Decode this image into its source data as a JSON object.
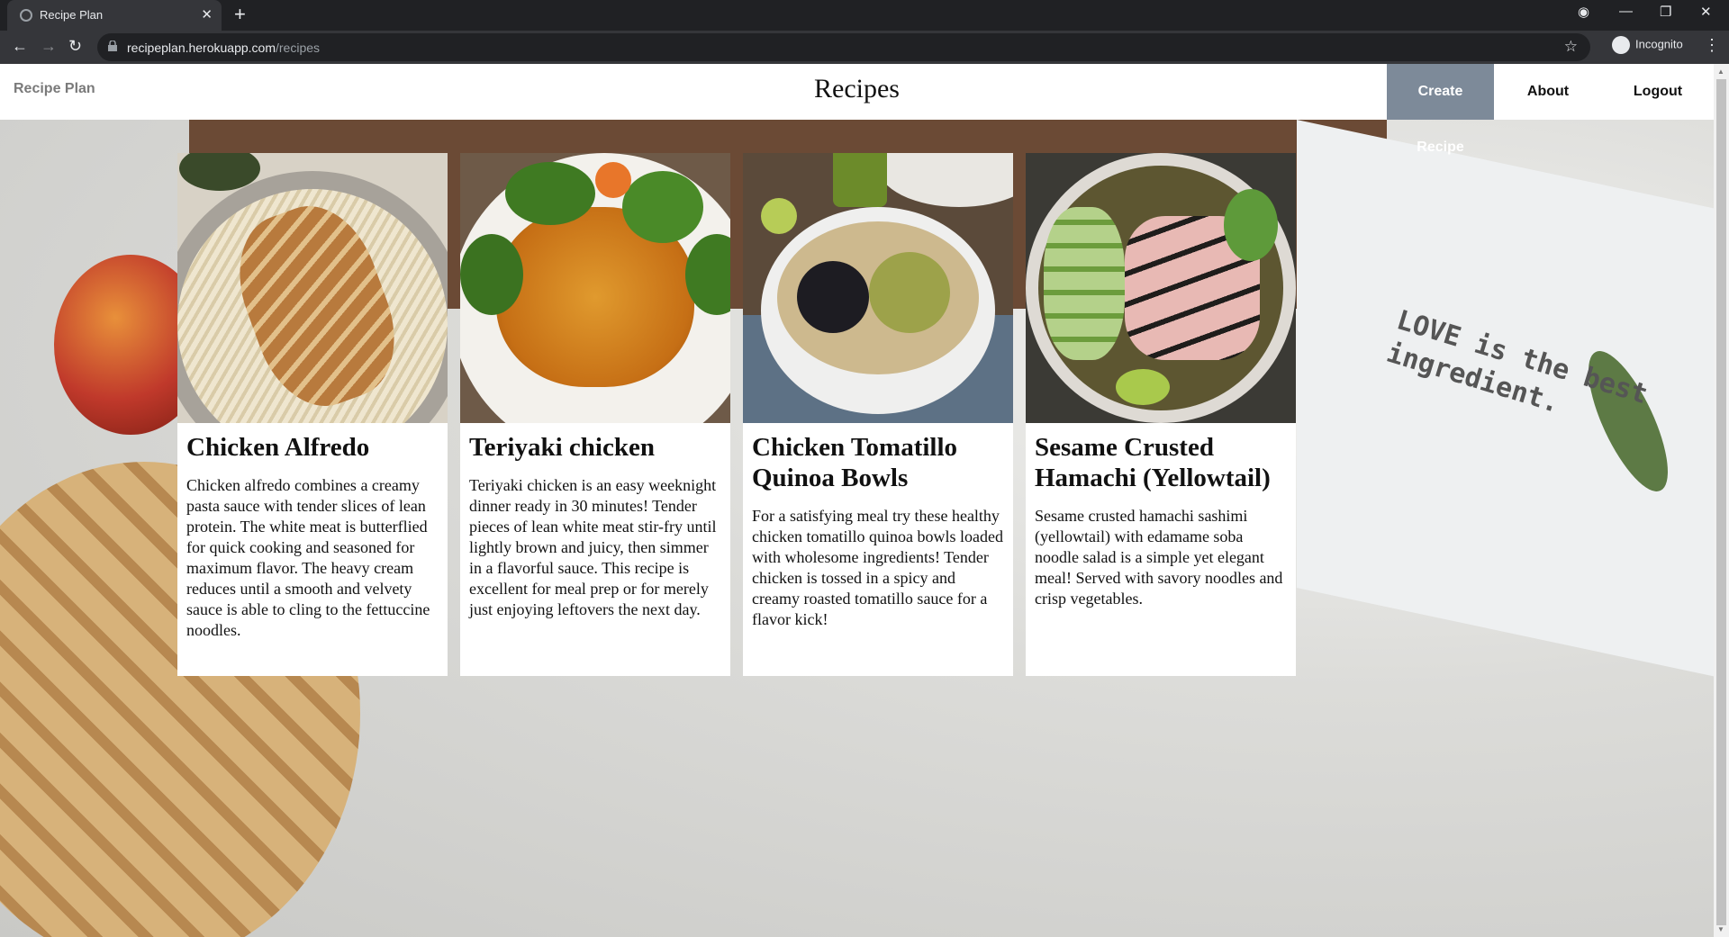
{
  "browser": {
    "tab_title": "Recipe Plan",
    "new_tab": "+",
    "url_host": "recipeplan.herokuapp.com",
    "url_path": "/recipes",
    "profile_label": "Incognito"
  },
  "navbar": {
    "brand": "Recipe Plan",
    "title": "Recipes",
    "links": {
      "create": "Create Recipe",
      "about": "About",
      "logout": "Logout"
    },
    "active_link_color": "#7d8a99"
  },
  "background_text": "LOVE is the best ingredient.",
  "recipes": [
    {
      "title": "Chicken Alfredo",
      "description": "Chicken alfredo combines a creamy pasta sauce with tender slices of lean protein. The white meat is butterflied for quick cooking and seasoned for maximum flavor. The heavy cream reduces until a smooth and velvety sauce is able to cling to the fettuccine noodles.",
      "image_icon": "chicken-alfredo-photo"
    },
    {
      "title": "Teriyaki chicken",
      "description": "Teriyaki chicken is an easy weeknight dinner ready in 30 minutes! Tender pieces of lean white meat stir-fry until lightly brown and juicy, then simmer in a flavorful sauce. This recipe is excellent for meal prep or for merely just enjoying leftovers the next day.",
      "image_icon": "teriyaki-chicken-photo"
    },
    {
      "title": "Chicken Tomatillo Quinoa Bowls",
      "description": "For a satisfying meal try these healthy chicken tomatillo quinoa bowls loaded with wholesome ingredients! Tender chicken is tossed in a spicy and creamy roasted tomatillo sauce for a flavor kick!",
      "image_icon": "quinoa-bowl-photo"
    },
    {
      "title": "Sesame Crusted Hamachi (Yellowtail)",
      "description": "Sesame crusted hamachi sashimi (yellowtail) with edamame soba noodle salad is a simple yet elegant meal! Served with savory noodles and crisp vegetables.",
      "image_icon": "hamachi-bowl-photo"
    }
  ]
}
